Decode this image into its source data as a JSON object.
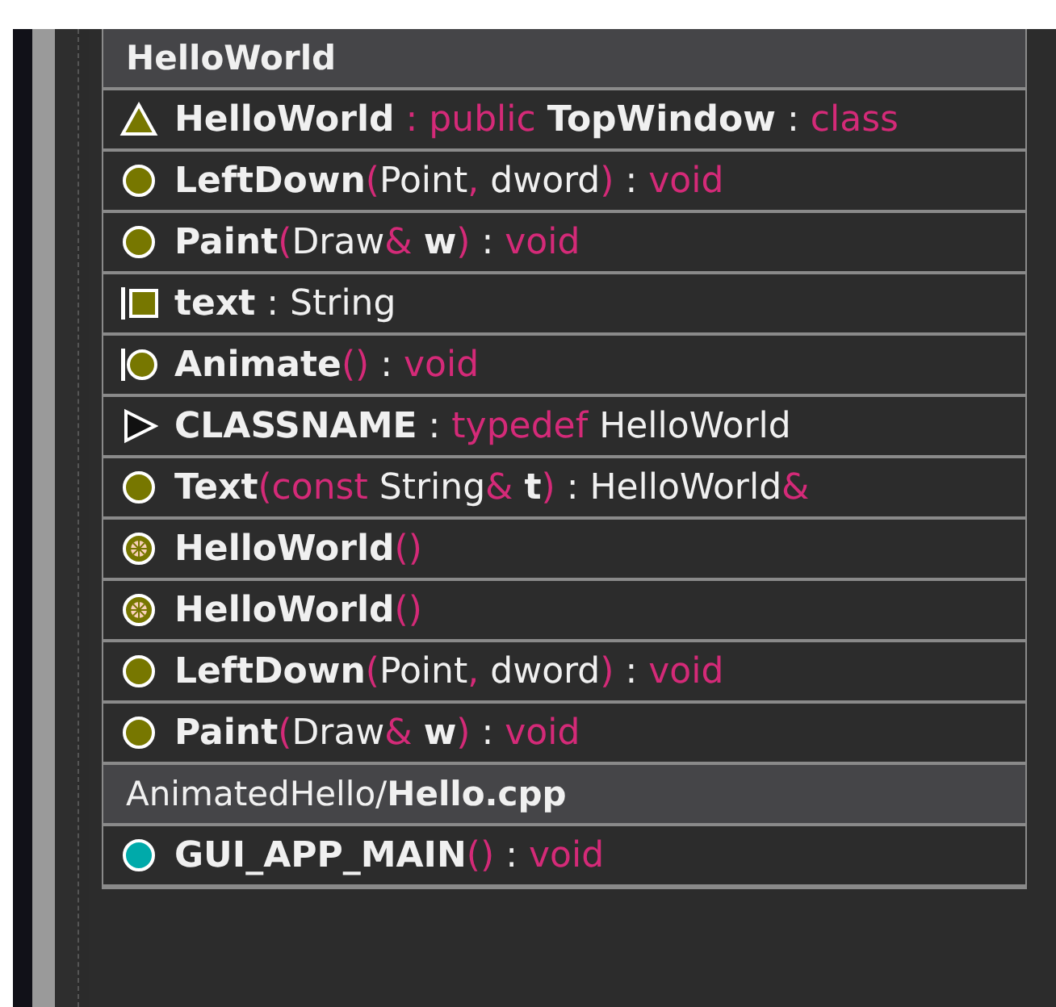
{
  "groups": [
    {
      "header": "HelloWorld",
      "rows": [
        {
          "kind": "class",
          "parts": [
            {
              "kind": "name",
              "text": "HelloWorld"
            },
            {
              "kind": "keyword",
              "text": " : public "
            },
            {
              "kind": "name",
              "text": "TopWindow"
            },
            {
              "kind": "plain",
              "text": " : "
            },
            {
              "kind": "keyword",
              "text": "class"
            }
          ]
        },
        {
          "kind": "method",
          "parts": [
            {
              "kind": "name",
              "text": "LeftDown"
            },
            {
              "kind": "keyword",
              "text": "("
            },
            {
              "kind": "plain",
              "text": "Point"
            },
            {
              "kind": "keyword",
              "text": ", "
            },
            {
              "kind": "plain",
              "text": "dword"
            },
            {
              "kind": "keyword",
              "text": ")"
            },
            {
              "kind": "plain",
              "text": " : "
            },
            {
              "kind": "keyword",
              "text": "void"
            }
          ]
        },
        {
          "kind": "method",
          "parts": [
            {
              "kind": "name",
              "text": "Paint"
            },
            {
              "kind": "keyword",
              "text": "("
            },
            {
              "kind": "plain",
              "text": "Draw"
            },
            {
              "kind": "keyword",
              "text": "& "
            },
            {
              "kind": "name",
              "text": "w"
            },
            {
              "kind": "keyword",
              "text": ")"
            },
            {
              "kind": "plain",
              "text": " : "
            },
            {
              "kind": "keyword",
              "text": "void"
            }
          ]
        },
        {
          "kind": "field",
          "parts": [
            {
              "kind": "name",
              "text": "text"
            },
            {
              "kind": "plain",
              "text": " : String"
            }
          ]
        },
        {
          "kind": "private-method",
          "parts": [
            {
              "kind": "name",
              "text": "Animate"
            },
            {
              "kind": "keyword",
              "text": "()"
            },
            {
              "kind": "plain",
              "text": " : "
            },
            {
              "kind": "keyword",
              "text": "void"
            }
          ]
        },
        {
          "kind": "typedef",
          "parts": [
            {
              "kind": "name",
              "text": "CLASSNAME"
            },
            {
              "kind": "plain",
              "text": " : "
            },
            {
              "kind": "keyword",
              "text": "typedef "
            },
            {
              "kind": "plain",
              "text": "HelloWorld"
            }
          ]
        },
        {
          "kind": "method",
          "parts": [
            {
              "kind": "name",
              "text": "Text"
            },
            {
              "kind": "keyword",
              "text": "(const "
            },
            {
              "kind": "plain",
              "text": "String"
            },
            {
              "kind": "keyword",
              "text": "& "
            },
            {
              "kind": "name",
              "text": "t"
            },
            {
              "kind": "keyword",
              "text": ")"
            },
            {
              "kind": "plain",
              "text": " : HelloWorld"
            },
            {
              "kind": "keyword",
              "text": "&"
            }
          ]
        },
        {
          "kind": "constructor",
          "parts": [
            {
              "kind": "name",
              "text": "HelloWorld"
            },
            {
              "kind": "keyword",
              "text": "()"
            }
          ]
        },
        {
          "kind": "constructor",
          "parts": [
            {
              "kind": "name",
              "text": "HelloWorld"
            },
            {
              "kind": "keyword",
              "text": "()"
            }
          ]
        },
        {
          "kind": "method",
          "parts": [
            {
              "kind": "name",
              "text": "LeftDown"
            },
            {
              "kind": "keyword",
              "text": "("
            },
            {
              "kind": "plain",
              "text": "Point"
            },
            {
              "kind": "keyword",
              "text": ", "
            },
            {
              "kind": "plain",
              "text": "dword"
            },
            {
              "kind": "keyword",
              "text": ")"
            },
            {
              "kind": "plain",
              "text": " : "
            },
            {
              "kind": "keyword",
              "text": "void"
            }
          ]
        },
        {
          "kind": "method",
          "parts": [
            {
              "kind": "name",
              "text": "Paint"
            },
            {
              "kind": "keyword",
              "text": "("
            },
            {
              "kind": "plain",
              "text": "Draw"
            },
            {
              "kind": "keyword",
              "text": "& "
            },
            {
              "kind": "name",
              "text": "w"
            },
            {
              "kind": "keyword",
              "text": ")"
            },
            {
              "kind": "plain",
              "text": " : "
            },
            {
              "kind": "keyword",
              "text": "void"
            }
          ]
        }
      ]
    },
    {
      "header": "AnimatedHello/**Hello.cpp**",
      "rows": [
        {
          "kind": "function",
          "parts": [
            {
              "kind": "name",
              "text": "GUI_APP_MAIN"
            },
            {
              "kind": "keyword",
              "text": "()"
            },
            {
              "kind": "plain",
              "text": " : "
            },
            {
              "kind": "keyword",
              "text": "void"
            }
          ]
        }
      ]
    }
  ]
}
